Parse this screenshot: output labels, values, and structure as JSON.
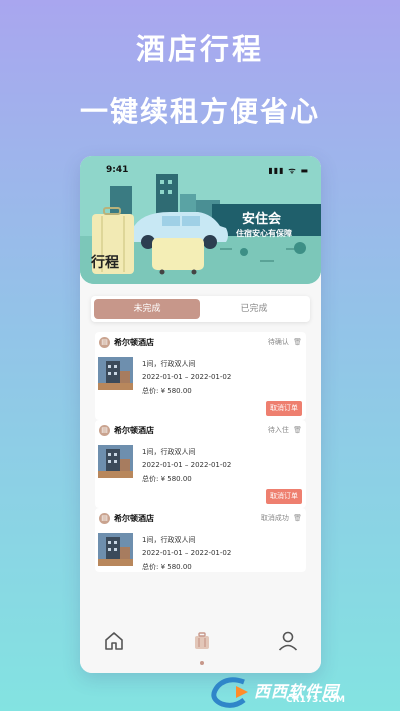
{
  "promo": {
    "title": "酒店行程",
    "subtitle": "一键续租方便省心"
  },
  "status_bar": {
    "time": "9:41",
    "icons": "▮▮▮ ᯤ ▬"
  },
  "hero": {
    "brand_name": "安住会",
    "brand_tagline": "住宿安心有保障",
    "page_title": "行程"
  },
  "tabs": [
    {
      "label": "未完成",
      "active": true
    },
    {
      "label": "已完成",
      "active": false
    }
  ],
  "orders": [
    {
      "hotel_icon": "hotel-icon",
      "hotel_name": "希尔顿酒店",
      "status": "待确认",
      "room": "1间，行政双人间",
      "dates": "2022-01-01 – 2022-01-02",
      "price": "总价: ¥ 580.00",
      "action": "取消订单"
    },
    {
      "hotel_icon": "hotel-icon",
      "hotel_name": "希尔顿酒店",
      "status": "待入住",
      "room": "1间，行政双人间",
      "dates": "2022-01-01 – 2022-01-02",
      "price": "总价: ¥ 580.00",
      "action": "取消订单"
    },
    {
      "hotel_icon": "hotel-icon",
      "hotel_name": "希尔顿酒店",
      "status": "取消成功",
      "room": "1间，行政双人间",
      "dates": "2022-01-01 – 2022-01-02",
      "price": "总价: ¥ 580.00"
    }
  ],
  "bottom_nav": [
    {
      "icon": "home-icon",
      "active": false
    },
    {
      "icon": "luggage-icon",
      "active": true
    },
    {
      "icon": "user-icon",
      "active": false
    }
  ],
  "watermark": {
    "main": "西西软件园",
    "sub": "CR173.COM"
  },
  "colors": {
    "accent": "#c7978a",
    "danger_button": "#ee7f6f",
    "hero_bg": "#8fd6ca",
    "brand_bar": "#1f5f6b"
  }
}
